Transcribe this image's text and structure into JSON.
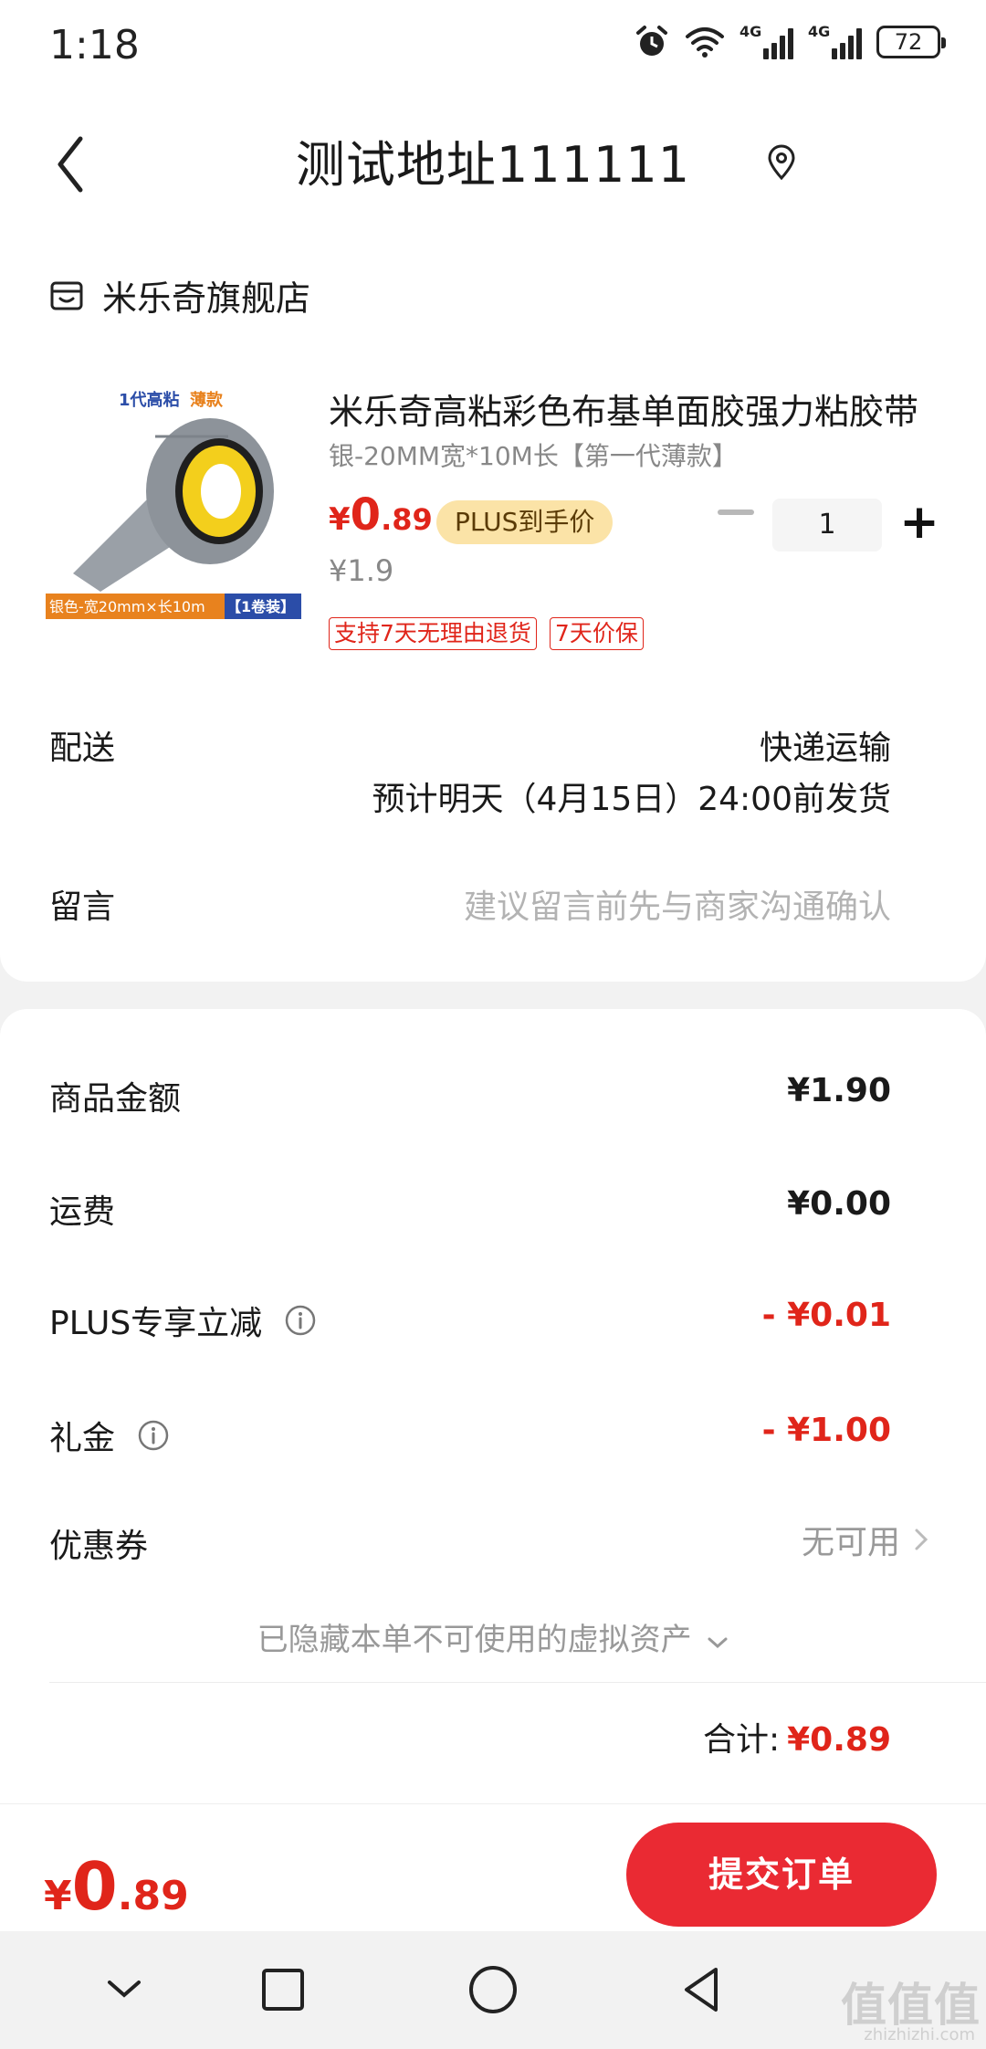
{
  "status_bar": {
    "time": "1:18",
    "net1": "4G",
    "net2": "4G",
    "battery": "72"
  },
  "header": {
    "address_title": "测试地址111111"
  },
  "shop": {
    "name": "米乐奇旗舰店"
  },
  "product": {
    "image_banner_top": "1代高粘",
    "image_banner_top_accent": "薄款",
    "image_banner_bottom": "银色-宽20mm×长10m",
    "image_banner_bottom_tag": "【1卷装】",
    "title": "米乐奇高粘彩色布基单面胶强力粘胶带",
    "spec": "银-20MM宽*10M长【第一代薄款】",
    "price_yen": "¥",
    "price_int": "0",
    "price_dec": ".89",
    "plus_badge": "PLUS到手价",
    "original_price": "¥1.9",
    "quantity": "1",
    "quantity_plus": "+",
    "service_tags": [
      "支持7天无理由退货",
      "7天价保"
    ]
  },
  "delivery": {
    "label": "配送",
    "method": "快递运输",
    "estimate": "预计明天（4月15日）24:00前发货"
  },
  "memo": {
    "label": "留言",
    "placeholder": "建议留言前先与商家沟通确认"
  },
  "summary": {
    "goods_label": "商品金额",
    "goods_value": "¥1.90",
    "shipping_label": "运费",
    "shipping_value": "¥0.00",
    "plus_label": "PLUS专享立减",
    "plus_value": "- ¥0.01",
    "gift_label": "礼金",
    "gift_value": "- ¥1.00",
    "coupon_label": "优惠券",
    "coupon_value": "无可用",
    "hidden_assets": "已隐藏本单不可使用的虚拟资产",
    "total_label": "合计:",
    "total_value": "¥0.89"
  },
  "bottom": {
    "price_yen": "¥",
    "price_int": "0",
    "price_dec": ".89",
    "submit_label": "提交订单"
  },
  "watermark": {
    "text": "值值值",
    "url": "zhizhizhi.com"
  },
  "colors": {
    "accent_red": "#e0251a",
    "button_red": "#ea2a33",
    "plus_gold": "#fbe3a7"
  }
}
